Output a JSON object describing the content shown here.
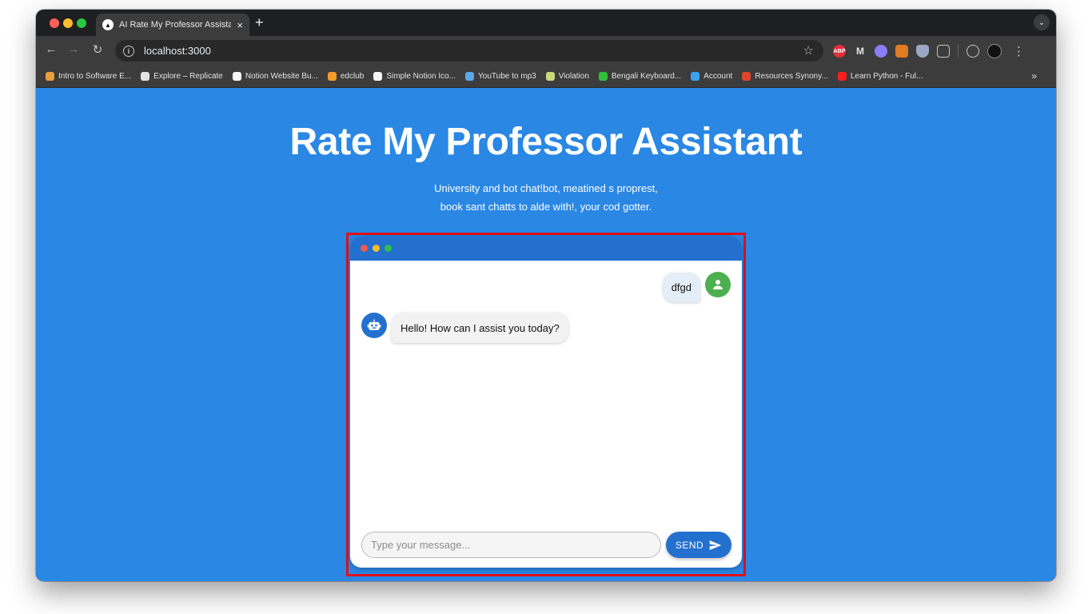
{
  "browser": {
    "tab_title": "AI Rate My Professor Assistant",
    "url": "localhost:3000",
    "bookmarks": [
      {
        "label": "Intro to Software E...",
        "color": "#e8a03c"
      },
      {
        "label": "Explore – Replicate",
        "color": "#e3e3e3"
      },
      {
        "label": "Notion Website Bu...",
        "color": "#f5f5f5"
      },
      {
        "label": "edclub",
        "color": "#f59d2a"
      },
      {
        "label": "Simple Notion Ico...",
        "color": "#f5f5f5"
      },
      {
        "label": "YouTube to mp3",
        "color": "#5aa7e8"
      },
      {
        "label": "Violation",
        "color": "#c9d87a"
      },
      {
        "label": "Bengali Keyboard...",
        "color": "#2fbf3a"
      },
      {
        "label": "Account",
        "color": "#3aa3ef"
      },
      {
        "label": "Resources Synony...",
        "color": "#e0462c"
      },
      {
        "label": "Learn Python - Ful...",
        "color": "#ff1f1f"
      }
    ],
    "more_label": "»"
  },
  "page": {
    "title": "Rate My Professor Assistant",
    "subtitle_line1": "University and bot chat!bot, meatined s proprest,",
    "subtitle_line2": "book sant chatts to alde with!, your cod gotter."
  },
  "chat": {
    "messages": [
      {
        "role": "user",
        "text": "dfgd"
      },
      {
        "role": "assistant",
        "text": "Hello! How can I assist you today?"
      }
    ],
    "input": {
      "placeholder": "Type your message...",
      "value": ""
    },
    "send_label": "SEND"
  },
  "colors": {
    "page_bg": "#2a87e4",
    "chat_header": "#2370cf",
    "user_avatar": "#4caf50",
    "highlight": "#e0101c"
  }
}
